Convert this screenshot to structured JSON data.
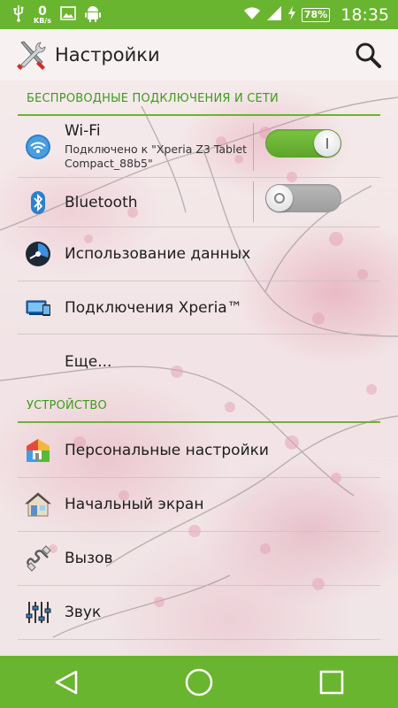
{
  "status_bar": {
    "network_speed_value": "0",
    "network_speed_unit": "KB/s",
    "battery": "78%",
    "time": "18:35"
  },
  "action_bar": {
    "title": "Настройки"
  },
  "sections": {
    "wireless": {
      "header": "БЕСПРОВОДНЫЕ ПОДКЛЮЧЕНИЯ И СЕТИ",
      "wifi": {
        "title": "Wi-Fi",
        "subtitle": "Подключено к \"Xperia Z3 Tablet Compact_88b5\"",
        "enabled": true
      },
      "bluetooth": {
        "title": "Bluetooth",
        "enabled": false
      },
      "data_usage": {
        "title": "Использование данных"
      },
      "xperia": {
        "title": "Подключения Xperia™"
      },
      "more": {
        "title": "Еще..."
      }
    },
    "device": {
      "header": "УСТРОЙСТВО",
      "personalization": {
        "title": "Персональные настройки"
      },
      "home_screen": {
        "title": "Начальный экран"
      },
      "call": {
        "title": "Вызов"
      },
      "sound": {
        "title": "Звук"
      }
    }
  },
  "colors": {
    "accent": "#6ab52f",
    "section_text": "#3f9a1e"
  }
}
